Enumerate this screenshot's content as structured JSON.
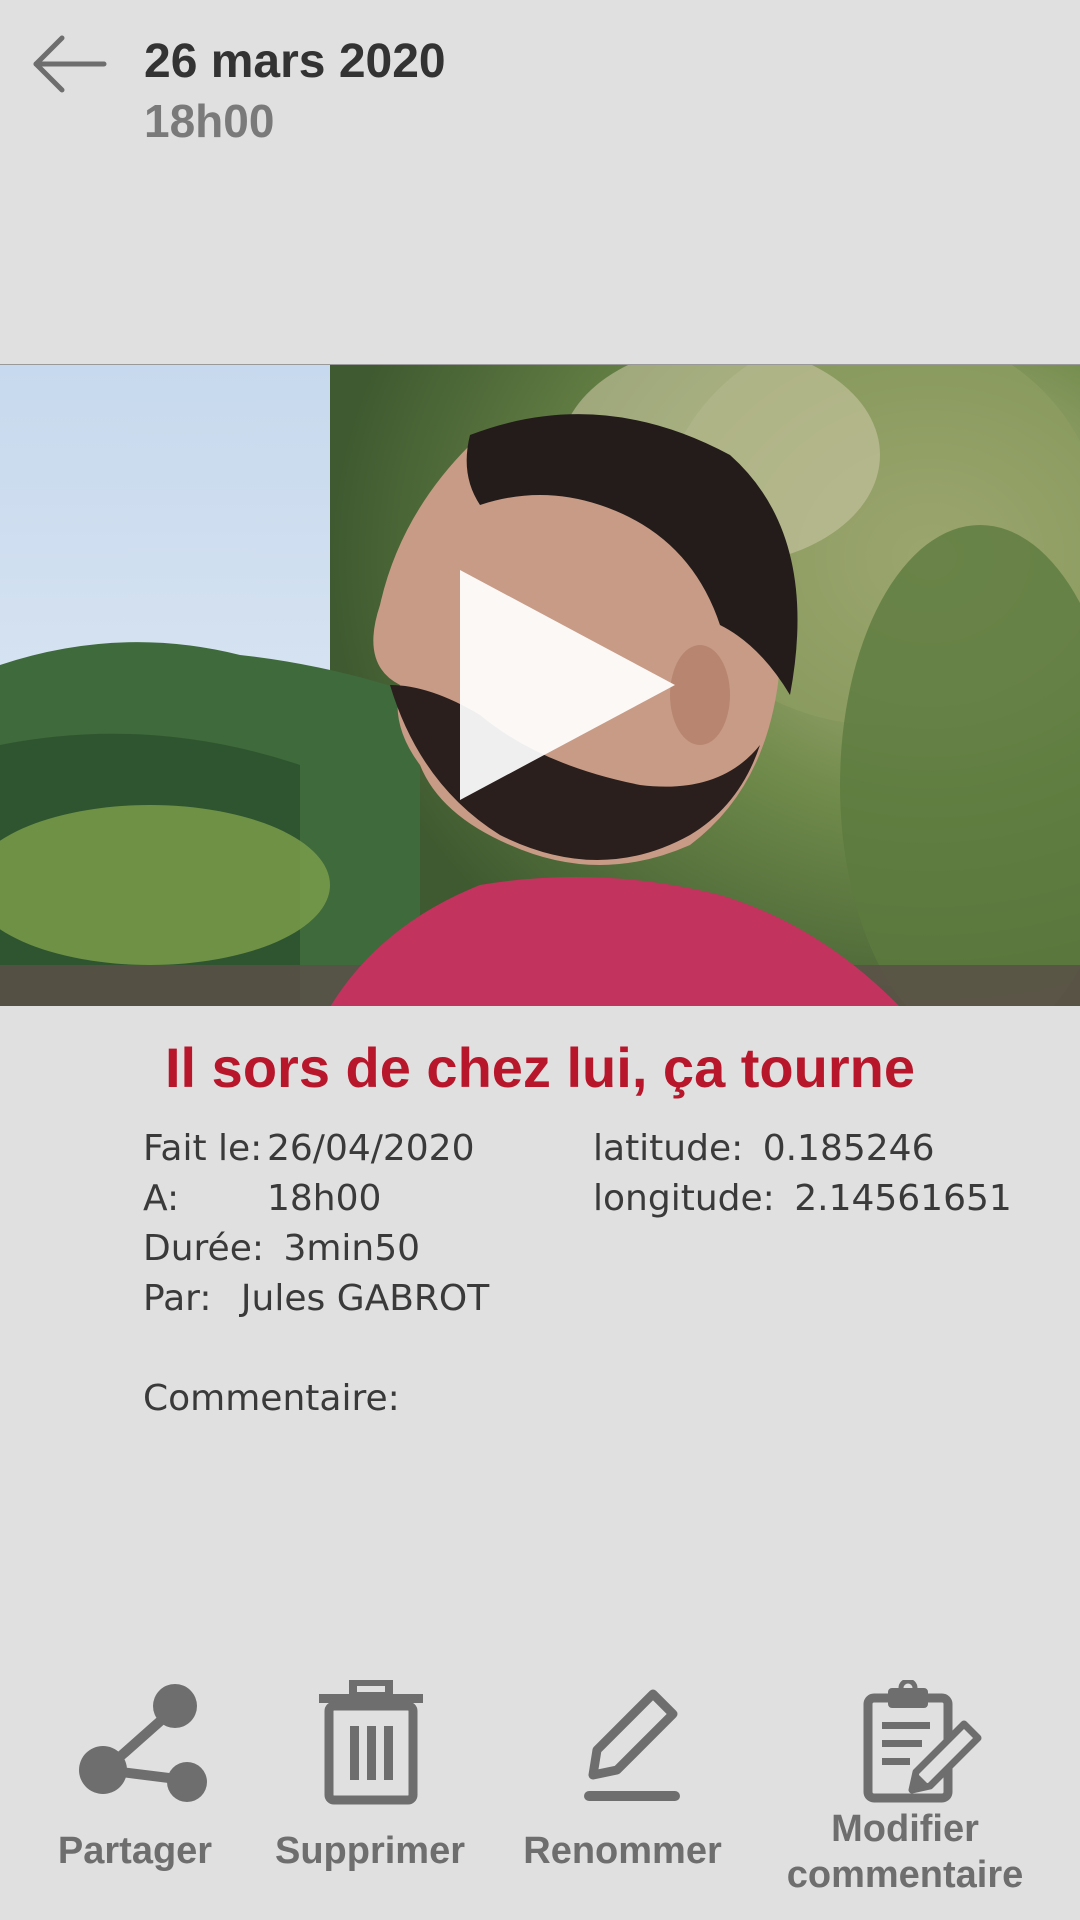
{
  "header": {
    "date": "26 mars 2020",
    "time": "18h00",
    "back_icon": "arrow-left-icon"
  },
  "video": {
    "play_icon": "play-icon"
  },
  "title": "Il sors de chez lui, ça tourne",
  "details": {
    "made_label": "Fait le:",
    "made_value": "26/04/2020",
    "at_label": "A:",
    "at_value": "18h00",
    "duration_label": "Durée:",
    "duration_value": "3min50",
    "by_label": "Par:",
    "by_value": "Jules GABROT",
    "latitude_label": "latitude:",
    "latitude_value": "0.185246",
    "longitude_label": "longitude:",
    "longitude_value": "2.14561651",
    "comment_label": "Commentaire:"
  },
  "actions": [
    {
      "label": "Partager",
      "icon": "share-icon"
    },
    {
      "label": "Supprimer",
      "icon": "trash-icon"
    },
    {
      "label": "Renommer",
      "icon": "pencil-icon"
    },
    {
      "label_line1": "Modifier",
      "label_line2": "commentaire",
      "icon": "clipboard-edit-icon"
    }
  ],
  "colors": {
    "background": "#e0e0e0",
    "title": "#b8172b",
    "icon": "#6e6e6e"
  }
}
